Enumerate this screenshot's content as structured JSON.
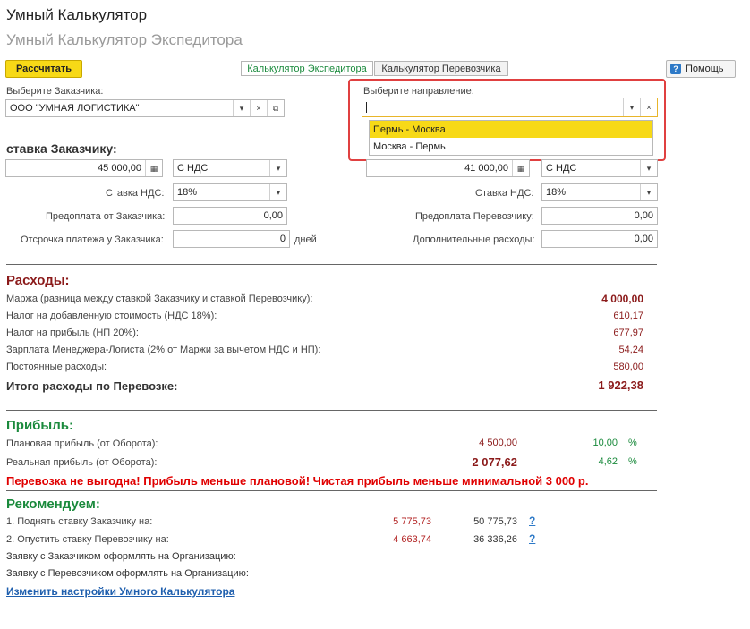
{
  "header": {
    "title": "Умный Калькулятор",
    "subtitle": "Умный Калькулятор Экспедитора"
  },
  "toolbar": {
    "calculate_label": "Рассчитать",
    "tabs": [
      "Калькулятор Экспедитора",
      "Калькулятор Перевозчика"
    ],
    "help_label": "Помощь"
  },
  "customer": {
    "label": "Выберите Заказчика:",
    "value": "ООО \"УМНАЯ ЛОГИСТИКА\""
  },
  "direction": {
    "label": "Выберите направление:",
    "value": "",
    "options": [
      "Пермь - Москва",
      "Москва - Пермь"
    ],
    "selected_option": "Пермь - Москва"
  },
  "rates": {
    "customer_rate_title": "ставка Заказчику:",
    "customer_rate": "45 000,00",
    "customer_vat_mode": "С НДС",
    "carrier_rate": "41 000,00",
    "carrier_vat_mode": "С НДС",
    "vat_label": "Ставка НДС:",
    "customer_vat": "18%",
    "carrier_vat": "18%",
    "customer_prepay_label": "Предоплата от Заказчика:",
    "customer_prepay": "0,00",
    "carrier_prepay_label": "Предоплата Перевозчику:",
    "carrier_prepay": "0,00",
    "delay_label": "Отсрочка платежа у Заказчика:",
    "delay_value": "0",
    "delay_unit": "дней",
    "extra_costs_label": "Дополнительные расходы:",
    "extra_costs": "0,00"
  },
  "expenses": {
    "title": "Расходы:",
    "rows": [
      {
        "label": "Маржа (разница между ставкой Заказчику и ставкой Перевозчику):",
        "value": "4 000,00"
      },
      {
        "label": "Налог на добавленную стоимость (НДС 18%):",
        "value": "610,17"
      },
      {
        "label": "Налог на прибыль (НП 20%):",
        "value": "677,97"
      },
      {
        "label": "Зарплата Менеджера-Логиста (2% от Маржи за вычетом НДС и НП):",
        "value": "54,24"
      },
      {
        "label": "Постоянные расходы:",
        "value": "580,00"
      }
    ],
    "total_label": "Итого расходы по Перевозке:",
    "total_value": "1 922,38"
  },
  "profit": {
    "title": "Прибыль:",
    "planned_label": "Плановая прибыль (от Оборота):",
    "planned_value": "4 500,00",
    "planned_pct": "10,00",
    "real_label": "Реальная прибыль (от Оборота):",
    "real_value": "2 077,62",
    "real_pct": "4,62",
    "pct_sign": "%"
  },
  "warning": "Перевозка не выгодна! Прибыль меньше плановой! Чистая прибыль меньше минимальной 3 000 р.",
  "recommend": {
    "title": "Рекомендуем:",
    "rows": [
      {
        "label": "1. Поднять ставку Заказчику на:",
        "delta": "5 775,73",
        "target": "50 775,73",
        "help": "?"
      },
      {
        "label": "2. Опустить ставку Перевозчику на:",
        "delta": "4 663,74",
        "target": "36 336,26",
        "help": "?"
      }
    ],
    "note1": "Заявку с Заказчиком оформлять на Организацию:",
    "note2": "Заявку с Перевозчиком оформлять на Организацию:",
    "settings_link": "Изменить настройки Умного Калькулятора"
  },
  "colors": {
    "accent_yellow": "#f7d917",
    "dark_red": "#8b1a1a",
    "green": "#1a8a3c",
    "warning_red": "#e00000",
    "link_blue": "#1f5fae",
    "highlight_red": "#e04040"
  }
}
